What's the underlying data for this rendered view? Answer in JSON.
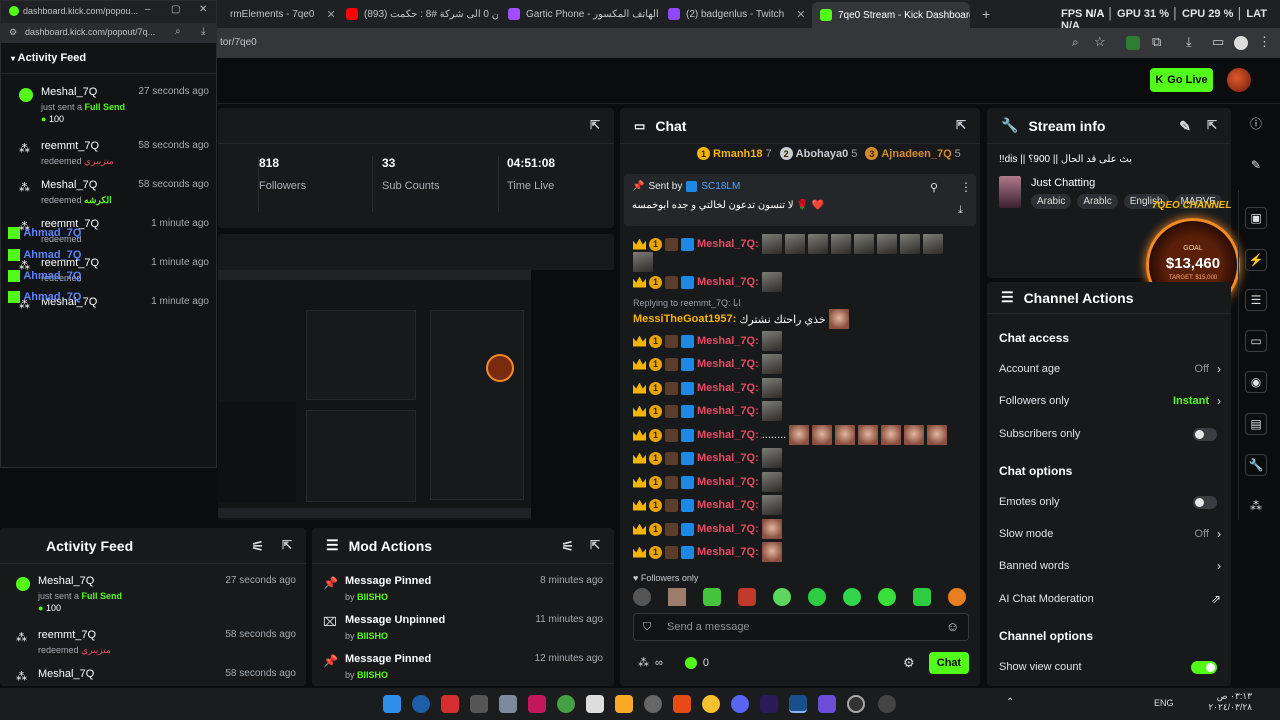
{
  "browser": {
    "tabs": [
      {
        "label": "rmElements - 7qe0",
        "color": "#6a6a6a"
      },
      {
        "label": "(893) من 0 الى شركة #8 : حكمت",
        "color": "#ff0000"
      },
      {
        "label": "Gartic Phone - الهاتف المكسور",
        "color": "#a44cff"
      },
      {
        "label": "(2) badgenlus - Twitch",
        "color": "#9146ff"
      },
      {
        "label": "7qe0 Stream - Kick Dashboard",
        "color": "#53fc18"
      }
    ],
    "url_fragment": "tor/7qe0",
    "perf": {
      "fps": "FPS",
      "fps_val": "N/A",
      "gpu": "GPU",
      "gpu_val": "31 %",
      "cpu": "CPU",
      "cpu_val": "29 %",
      "lat": "LAT",
      "lat_val": "N/A"
    }
  },
  "header": {
    "go_live": "Go Live"
  },
  "stats": {
    "followers": "818",
    "followers_label": "Followers",
    "subs": "33",
    "subs_label": "Sub Counts",
    "time": "04:51:08",
    "time_label": "Time Live"
  },
  "chat": {
    "title": "Chat",
    "leaders": [
      {
        "rank": "1",
        "name": "Rmanh18",
        "count": "7"
      },
      {
        "rank": "2",
        "name": "Abohaya0",
        "count": "5"
      },
      {
        "rank": "3",
        "name": "Ajnadeen_7Q",
        "count": "5"
      }
    ],
    "pinned_label": "Sent by",
    "pinned_user": "SC18LM",
    "pinned_message": "لا تنسون تدعون لخالتي و جده ابوخمسه 🌹 ❤️",
    "reply_label": "Replying to reemmt_7Q: ابا",
    "reply_user": "MessiTheGoat1957:",
    "reply_text": "خذي راحتك نشترك",
    "user": "Meshal_7Q:",
    "dots_text": "........",
    "followers_only": "Followers only",
    "placeholder": "Send a message",
    "points": "0",
    "send_label": "Chat"
  },
  "stream_info": {
    "title": "Stream info",
    "stream_title": "بث على قد الحال || 900؟ || dis!!",
    "category": "Just Chatting",
    "tags": [
      "Arabic",
      "Arablc",
      "English",
      "MARVE"
    ]
  },
  "overlay": {
    "goal": "$13,460",
    "goal_label": "GOAL",
    "target": "TARGET: $15,000",
    "channel": "7QEO CHANNEL"
  },
  "channel_actions": {
    "title": "Channel Actions",
    "chat_access": "Chat access",
    "account_age": "Account age",
    "account_age_val": "Off",
    "followers_only": "Followers only",
    "followers_only_val": "Instant",
    "subscribers_only": "Subscribers only",
    "chat_options": "Chat options",
    "emotes_only": "Emotes only",
    "slow_mode": "Slow mode",
    "slow_mode_val": "Off",
    "banned_words": "Banned words",
    "ai_moderation": "AI Chat Moderation",
    "channel_options": "Channel options",
    "show_view_count": "Show view count"
  },
  "activity_feed": {
    "title": "Activity Feed",
    "items": [
      {
        "name": "Meshal_7Q",
        "time": "27 seconds ago",
        "action": "just sent a",
        "item": "Full Send",
        "amount": "100"
      },
      {
        "name": "reemmt_7Q",
        "time": "58 seconds ago",
        "action": "redeemed",
        "item": "متزيبري"
      },
      {
        "name": "Meshal_7Q",
        "time": "58 seconds ago",
        "action": "redeemed",
        "item": "الكرشه"
      },
      {
        "name": "reemmt_7Q",
        "time": "1 minute ago",
        "action": "redeemed",
        "item": ""
      },
      {
        "name": "reemmt_7Q",
        "time": "1 minute ago",
        "action": "redeemed",
        "item": ""
      },
      {
        "name": "Meshal_7Q",
        "time": "1 minute ago",
        "action": "",
        "item": ""
      }
    ]
  },
  "popout": {
    "url": "dashboard.kick.com/popou...",
    "url2": "dashboard.kick.com/popout/7q...",
    "title": "Activity Feed",
    "overlay_names": [
      "Ahmad_7Q",
      "Ahmad_7Q",
      "Ahmad_7Q",
      "Ahmad_7Q"
    ]
  },
  "bottom_feed": {
    "title": "Activity Feed",
    "items": [
      {
        "name": "Meshal_7Q",
        "time": "27 seconds ago",
        "action": "just sent a",
        "item": "Full Send",
        "amount": "100"
      },
      {
        "name": "reemmt_7Q",
        "time": "58 seconds ago",
        "action": "redeemed",
        "item": "متزيبري"
      },
      {
        "name": "Meshal_7Q",
        "time": "58 seconds ago"
      }
    ]
  },
  "mod_actions": {
    "title": "Mod Actions",
    "items": [
      {
        "title": "Message Pinned",
        "by": "by",
        "user": "BIISHO",
        "time": "8 minutes ago"
      },
      {
        "title": "Message Unpinned",
        "by": "by",
        "user": "BIISHO",
        "time": "11 minutes ago"
      },
      {
        "title": "Message Pinned",
        "by": "by",
        "user": "BIISHO",
        "time": "12 minutes ago"
      }
    ]
  },
  "taskbar": {
    "lang": "ENG",
    "time": "٠٣:١٣ ص",
    "date": "٢٠٢٤/٠٣/٢٨"
  }
}
